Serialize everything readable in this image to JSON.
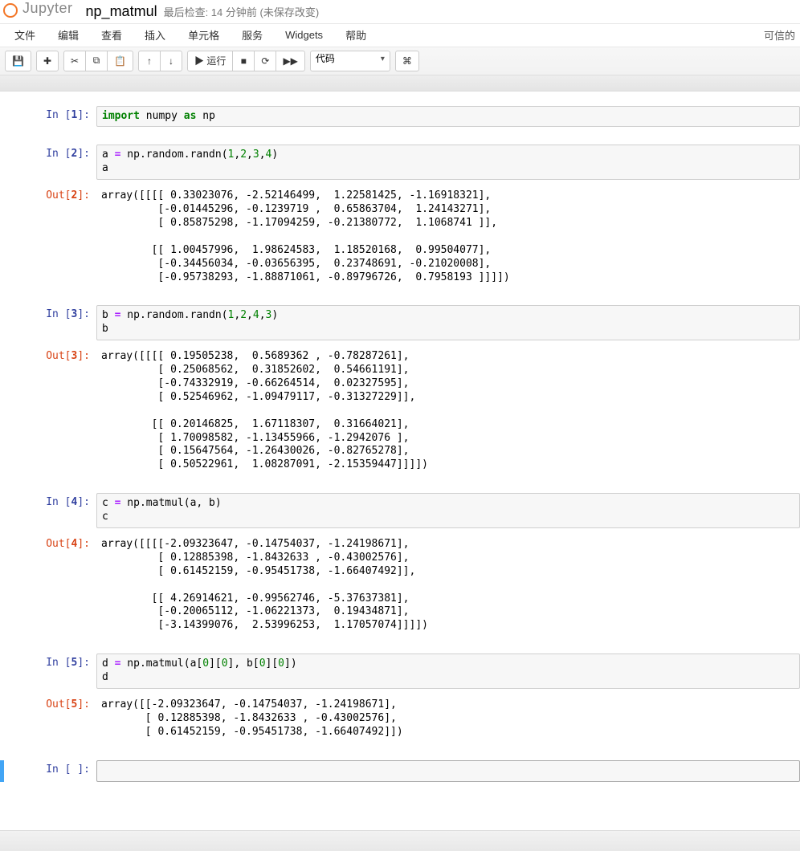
{
  "header": {
    "logo_text": "Jupyter",
    "notebook_name": "np_matmul",
    "checkpoint": "最后检查: 14 分钟前  (未保存改变)"
  },
  "menu": {
    "file": "文件",
    "edit": "编辑",
    "view": "查看",
    "insert": "插入",
    "cell": "单元格",
    "kernel": "服务",
    "widgets": "Widgets",
    "help": "帮助",
    "trusted": "可信的"
  },
  "toolbar": {
    "save_icon": "💾",
    "add": "✚",
    "cut": "✂",
    "copy": "⧉",
    "paste": "📋",
    "up": "↑",
    "down": "↓",
    "run": "▶ 运行",
    "stop": "■",
    "restart": "⟳",
    "ff": "▶▶",
    "celltype": "代码",
    "cmd": "⌘"
  },
  "cells": [
    {
      "in_n": "1",
      "out_n": null,
      "output": null
    },
    {
      "in_n": "2",
      "out_n": "2",
      "output": "array([[[[ 0.33023076, -2.52146499,  1.22581425, -1.16918321],\n         [-0.01445296, -0.1239719 ,  0.65863704,  1.24143271],\n         [ 0.85875298, -1.17094259, -0.21380772,  1.1068741 ]],\n\n        [[ 1.00457996,  1.98624583,  1.18520168,  0.99504077],\n         [-0.34456034, -0.03656395,  0.23748691, -0.21020008],\n         [-0.95738293, -1.88871061, -0.89796726,  0.7958193 ]]]])"
    },
    {
      "in_n": "3",
      "out_n": "3",
      "output": "array([[[[ 0.19505238,  0.5689362 , -0.78287261],\n         [ 0.25068562,  0.31852602,  0.54661191],\n         [-0.74332919, -0.66264514,  0.02327595],\n         [ 0.52546962, -1.09479117, -0.31327229]],\n\n        [[ 0.20146825,  1.67118307,  0.31664021],\n         [ 1.70098582, -1.13455966, -1.2942076 ],\n         [ 0.15647564, -1.26430026, -0.82765278],\n         [ 0.50522961,  1.08287091, -2.15359447]]]])"
    },
    {
      "in_n": "4",
      "out_n": "4",
      "output": "array([[[[-2.09323647, -0.14754037, -1.24198671],\n         [ 0.12885398, -1.8432633 , -0.43002576],\n         [ 0.61452159, -0.95451738, -1.66407492]],\n\n        [[ 4.26914621, -0.99562746, -5.37637381],\n         [-0.20065112, -1.06221373,  0.19434871],\n         [-3.14399076,  2.53996253,  1.17057074]]]])"
    },
    {
      "in_n": "5",
      "out_n": "5",
      "output": "array([[-2.09323647, -0.14754037, -1.24198671],\n       [ 0.12885398, -1.8432633 , -0.43002576],\n       [ 0.61452159, -0.95451738, -1.66407492]])"
    }
  ],
  "empty_prompt": "In [ ]:"
}
